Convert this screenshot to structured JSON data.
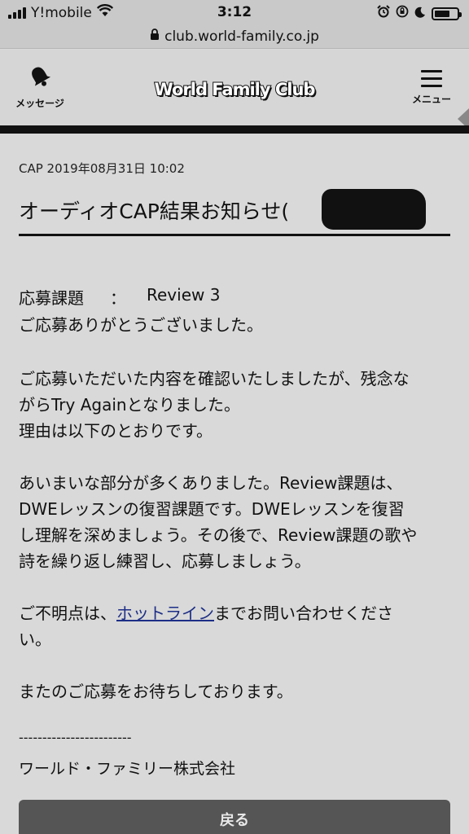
{
  "status_bar": {
    "carrier": "Y!mobile",
    "time": "3:12"
  },
  "browser": {
    "url": "club.world-family.co.jp"
  },
  "header": {
    "message_label": "メッセージ",
    "menu_label": "メニュー",
    "logo_text": "World Family Club"
  },
  "notice": {
    "date": "CAP 2019年08月31日 10:02",
    "title": "オーディオCAP結果お知らせ(",
    "task_label": "応募課題",
    "task_colon": "：",
    "task_value": "Review 3",
    "thanks": "ご応募ありがとうございました。",
    "para1_line1": "ご応募いただいた内容を確認いたしましたが、残念な",
    "para1_line2": "がらTry Againとなりました。",
    "para1_line3": "理由は以下のとおりです。",
    "para2_line1": "あいまいな部分が多くありました。Review課題は、",
    "para2_line2": "DWEレッスンの復習課題です。DWEレッスンを復習",
    "para2_line3": "し理解を深めましょう。その後で、Review課題の歌や",
    "para2_line4": "詩を繰り返し練習し、応募しましょう。",
    "para3_before": "ご不明点は、",
    "para3_link": "ホットライン",
    "para3_after": "までお問い合わせくださ",
    "para3_line2": "い。",
    "closing": "またのご応募をお待ちしております。",
    "divider": "------------------------",
    "signature": "ワールド・ファミリー株式会社",
    "back_button": "戻る"
  }
}
